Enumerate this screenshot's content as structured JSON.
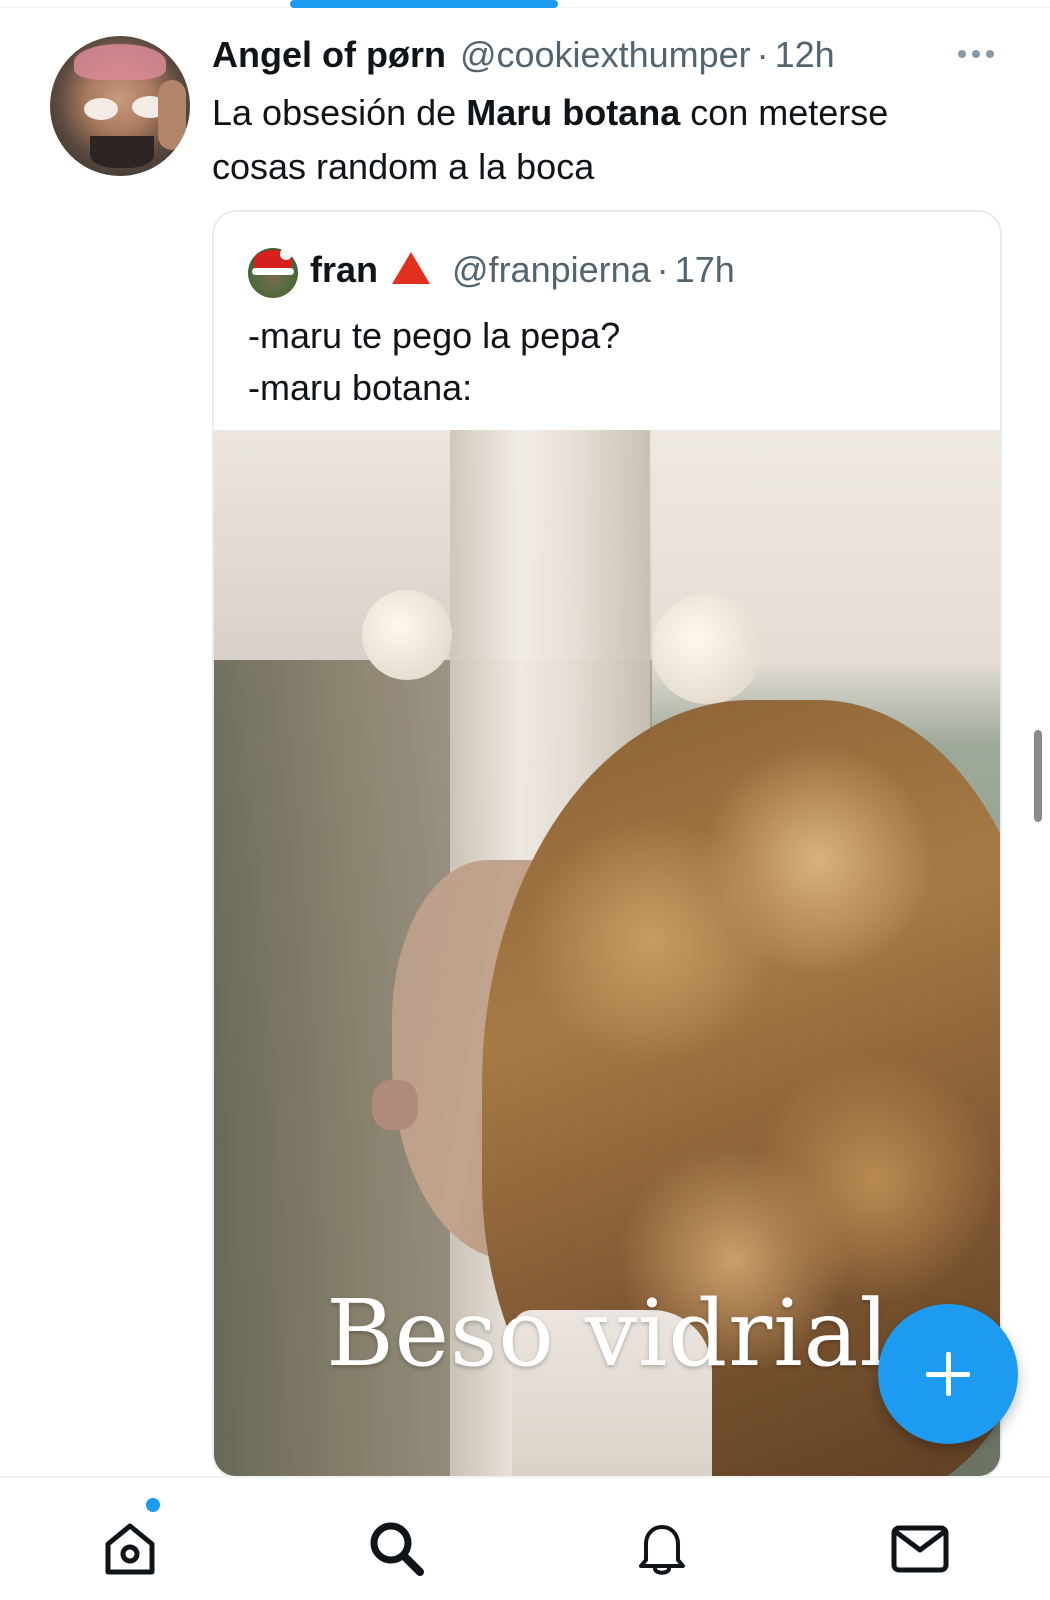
{
  "tweet": {
    "display_name": "Angel of pørn",
    "handle": "@cookiexthumper",
    "separator": "·",
    "time": "12h",
    "text_before": "La obsesión de ",
    "text_bold": "Maru botana",
    "text_after": " con meterse cosas random a la boca"
  },
  "quote": {
    "display_name": "fran",
    "handle": "@franpierna",
    "separator": "·",
    "time": "17h",
    "lines": [
      "-maru te pego la pepa?",
      "-maru botana:"
    ],
    "media_caption": "Beso vidrial"
  },
  "bottom_nav": {
    "items": [
      "home-icon",
      "search-icon",
      "notifications-icon",
      "messages-icon"
    ],
    "home_has_notification": true
  },
  "colors": {
    "accent": "#1d9bf0",
    "text_primary": "#0f1419",
    "text_secondary": "#536471",
    "badge": "#e0301e"
  }
}
